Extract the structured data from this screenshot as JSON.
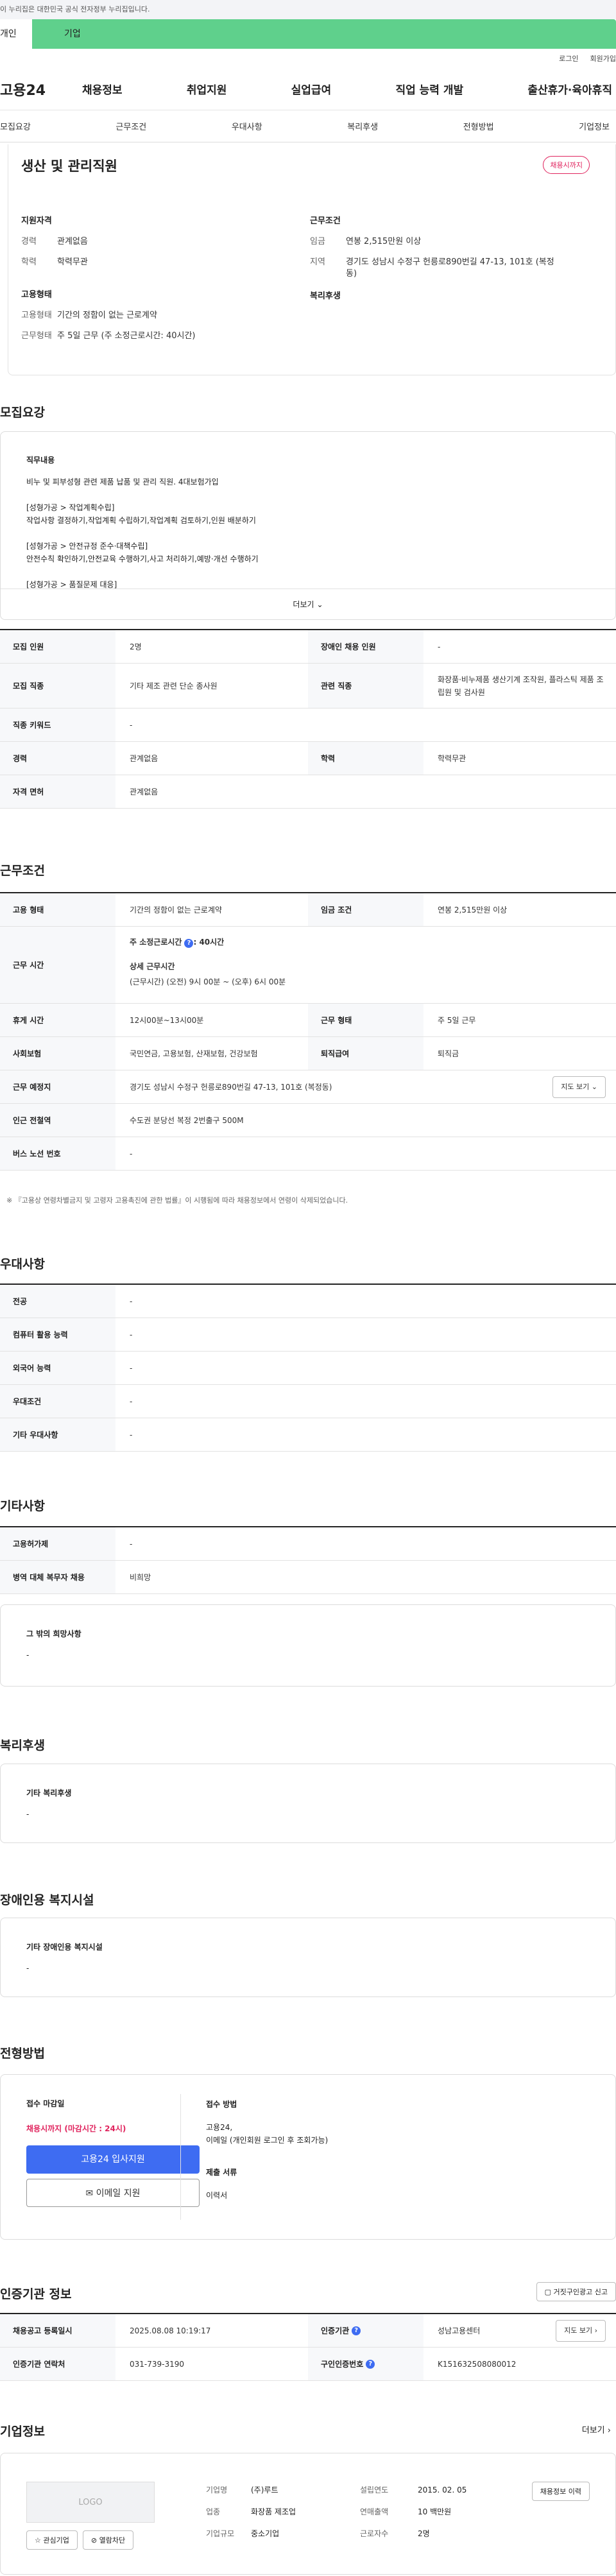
{
  "gov_banner": "이 누리집은 대한민국 공식 전자정부 누리집입니다.",
  "tabs": [
    "개인",
    "기업"
  ],
  "util_links": [
    "로그인",
    "회원가입"
  ],
  "logo": "고용24",
  "gnb": [
    "채용정보",
    "취업지원",
    "실업급여",
    "직업 능력 개발",
    "출산휴가·육아휴직"
  ],
  "anchors": [
    "모집요강",
    "근무조건",
    "우대사항",
    "복리후생",
    "전형방법",
    "기업정보"
  ],
  "summary": {
    "title": "생산 및 관리직원",
    "badge": "채용시까지",
    "qual_title": "지원자격",
    "cond_title": "근무조건",
    "emp_title": "고용형태",
    "welfare_title": "복리후생",
    "career_k": "경력",
    "career_v": "관계없음",
    "edu_k": "학력",
    "edu_v": "학력무관",
    "wage_k": "임금",
    "wage_v": "연봉 2,515만원 이상",
    "region_k": "지역",
    "region_v": "경기도 성남시 수정구 헌릉로890번길 47-13, 101호 (복정동)",
    "emptype_k": "고용형태",
    "emptype_v": "기간의 정함이 없는 근로계약",
    "worktype_k": "근무형태",
    "worktype_v": "주 5일 근무 (주 소정근로시간: 40시간)"
  },
  "recruit": {
    "title": "모집요강",
    "duty_title": "직무내용",
    "duty_lines": [
      "비누 및 피부성형 관련 제품 납품 및 관리 직원. 4대보험가입",
      "",
      "[성형가공 > 작업계획수립]",
      "작업사항 결정하기,작업계획 수립하기,작업계획 검토하기,인원 배분하기",
      "",
      "[성형가공 > 안전규정 준수·대책수립]",
      "안전수칙 확인하기,안전교육 수행하기,사고 처리하기,예방·개선 수행하기",
      "",
      "[성형가공 > 품질문제 대응]"
    ],
    "more": "더보기",
    "rows": {
      "headcount_k": "모집 인원",
      "headcount_v": "2명",
      "disabled_k": "장애인 채용 인원",
      "disabled_v": "-",
      "job_k": "모집 직종",
      "job_v": "기타 제조 관련 단순 종사원",
      "related_k": "관련 직종",
      "related_v": "화장품·비누제품 생산기계 조작원, 플라스틱 제품 조립원 및 검사원",
      "keyword_k": "직종 키워드",
      "keyword_v": "-",
      "career_k": "경력",
      "career_v": "관계없음",
      "edu_k": "학력",
      "edu_v": "학력무관",
      "license_k": "자격 면허",
      "license_v": "관계없음"
    }
  },
  "conditions": {
    "title": "근무조건",
    "emptype_k": "고용 형태",
    "emptype_v": "기간의 정함이 없는 근로계약",
    "wage_k": "임금 조건",
    "wage_v": "연봉 2,515만원 이상",
    "hours_k": "근무 시간",
    "hours_weekly": "주 소정근로시간",
    "hours_weekly_v": ": 40시간",
    "hours_detail_title": "상세 근무시간",
    "hours_detail_v": "(근무시간) (오전) 9시 00분 ~ (오후) 6시 00분",
    "break_k": "휴게 시간",
    "break_v": "12시00분~13시00분",
    "form_k": "근무 형태",
    "form_v": "주 5일 근무",
    "insurance_k": "사회보험",
    "insurance_v": "국민연금, 고용보험, 산재보험, 건강보험",
    "retire_k": "퇴직급여",
    "retire_v": "퇴직금",
    "place_k": "근무 예정지",
    "place_v": "경기도 성남시 수정구 헌릉로890번길 47-13, 101호 (복정동)",
    "map_btn": "지도 보기",
    "subway_k": "인근 전철역",
    "subway_v": "수도권 분당선 복정 2번출구 500M",
    "bus_k": "버스 노선 번호",
    "bus_v": "-",
    "note": "※ 『고용상 연령차별금지 및 고령자 고용촉진에 관한 법률』이 시행됨에 따라 채용정보에서 연령이 삭제되었습니다."
  },
  "preferences": {
    "title": "우대사항",
    "major_k": "전공",
    "major_v": "-",
    "computer_k": "컴퓨터 활용 능력",
    "computer_v": "-",
    "lang_k": "외국어 능력",
    "lang_v": "-",
    "cond_k": "우대조건",
    "cond_v": "-",
    "etc_k": "기타 우대사항",
    "etc_v": "-"
  },
  "other": {
    "title": "기타사항",
    "hire_k": "고용허가제",
    "hire_v": "-",
    "military_k": "병역 대체 복무자 채용",
    "military_v": "비희망",
    "etc_title": "그 밖의 희망사항",
    "etc_v": "-"
  },
  "welfare": {
    "title": "복리후생",
    "box_title": "기타 복리후생",
    "box_v": "-"
  },
  "disabled_facility": {
    "title": "장애인용 복지시설",
    "box_title": "기타 장애인용 복지시설",
    "box_v": "-"
  },
  "selection": {
    "title": "전형방법",
    "deadline_title": "접수 마감일",
    "deadline_v": "채용시까지 (마감시간 : 24시)",
    "apply_btn": "고용24 입사지원",
    "email_btn": "이메일 지원",
    "method_title": "접수 방법",
    "method_v1": "고용24,",
    "method_v2": "이메일 (개인회원 로그인 후 조회가능)",
    "docs_title": "제출 서류",
    "docs_v": "이력서"
  },
  "agency": {
    "title": "인증기관 정보",
    "report_btn": "거짓구인광고 신고",
    "date_k": "채용공고 등록일시",
    "date_v": "2025.08.08 10:19:17",
    "org_k": "인증기관",
    "org_v": "성남고용센터",
    "map_btn": "지도 보기",
    "contact_k": "인증기관 연락처",
    "contact_v": "031-739-3190",
    "reqno_k": "구인인증번호",
    "reqno_v": "K151632508080012"
  },
  "company": {
    "title": "기업정보",
    "more": "더보기",
    "logo": "LOGO",
    "interest_btn": "관심기업",
    "block_btn": "열람차단",
    "name_k": "기업명",
    "name_v": "(주)루트",
    "founded_k": "설립연도",
    "founded_v": "2015. 02. 05",
    "jobs_btn": "채용정보 이력",
    "industry_k": "업종",
    "industry_v": "화장품 제조업",
    "sales_k": "연매출액",
    "sales_v": "10 백만원",
    "size_k": "기업규모",
    "size_v": "중소기업",
    "employees_k": "근로자수",
    "employees_v": "2명"
  }
}
